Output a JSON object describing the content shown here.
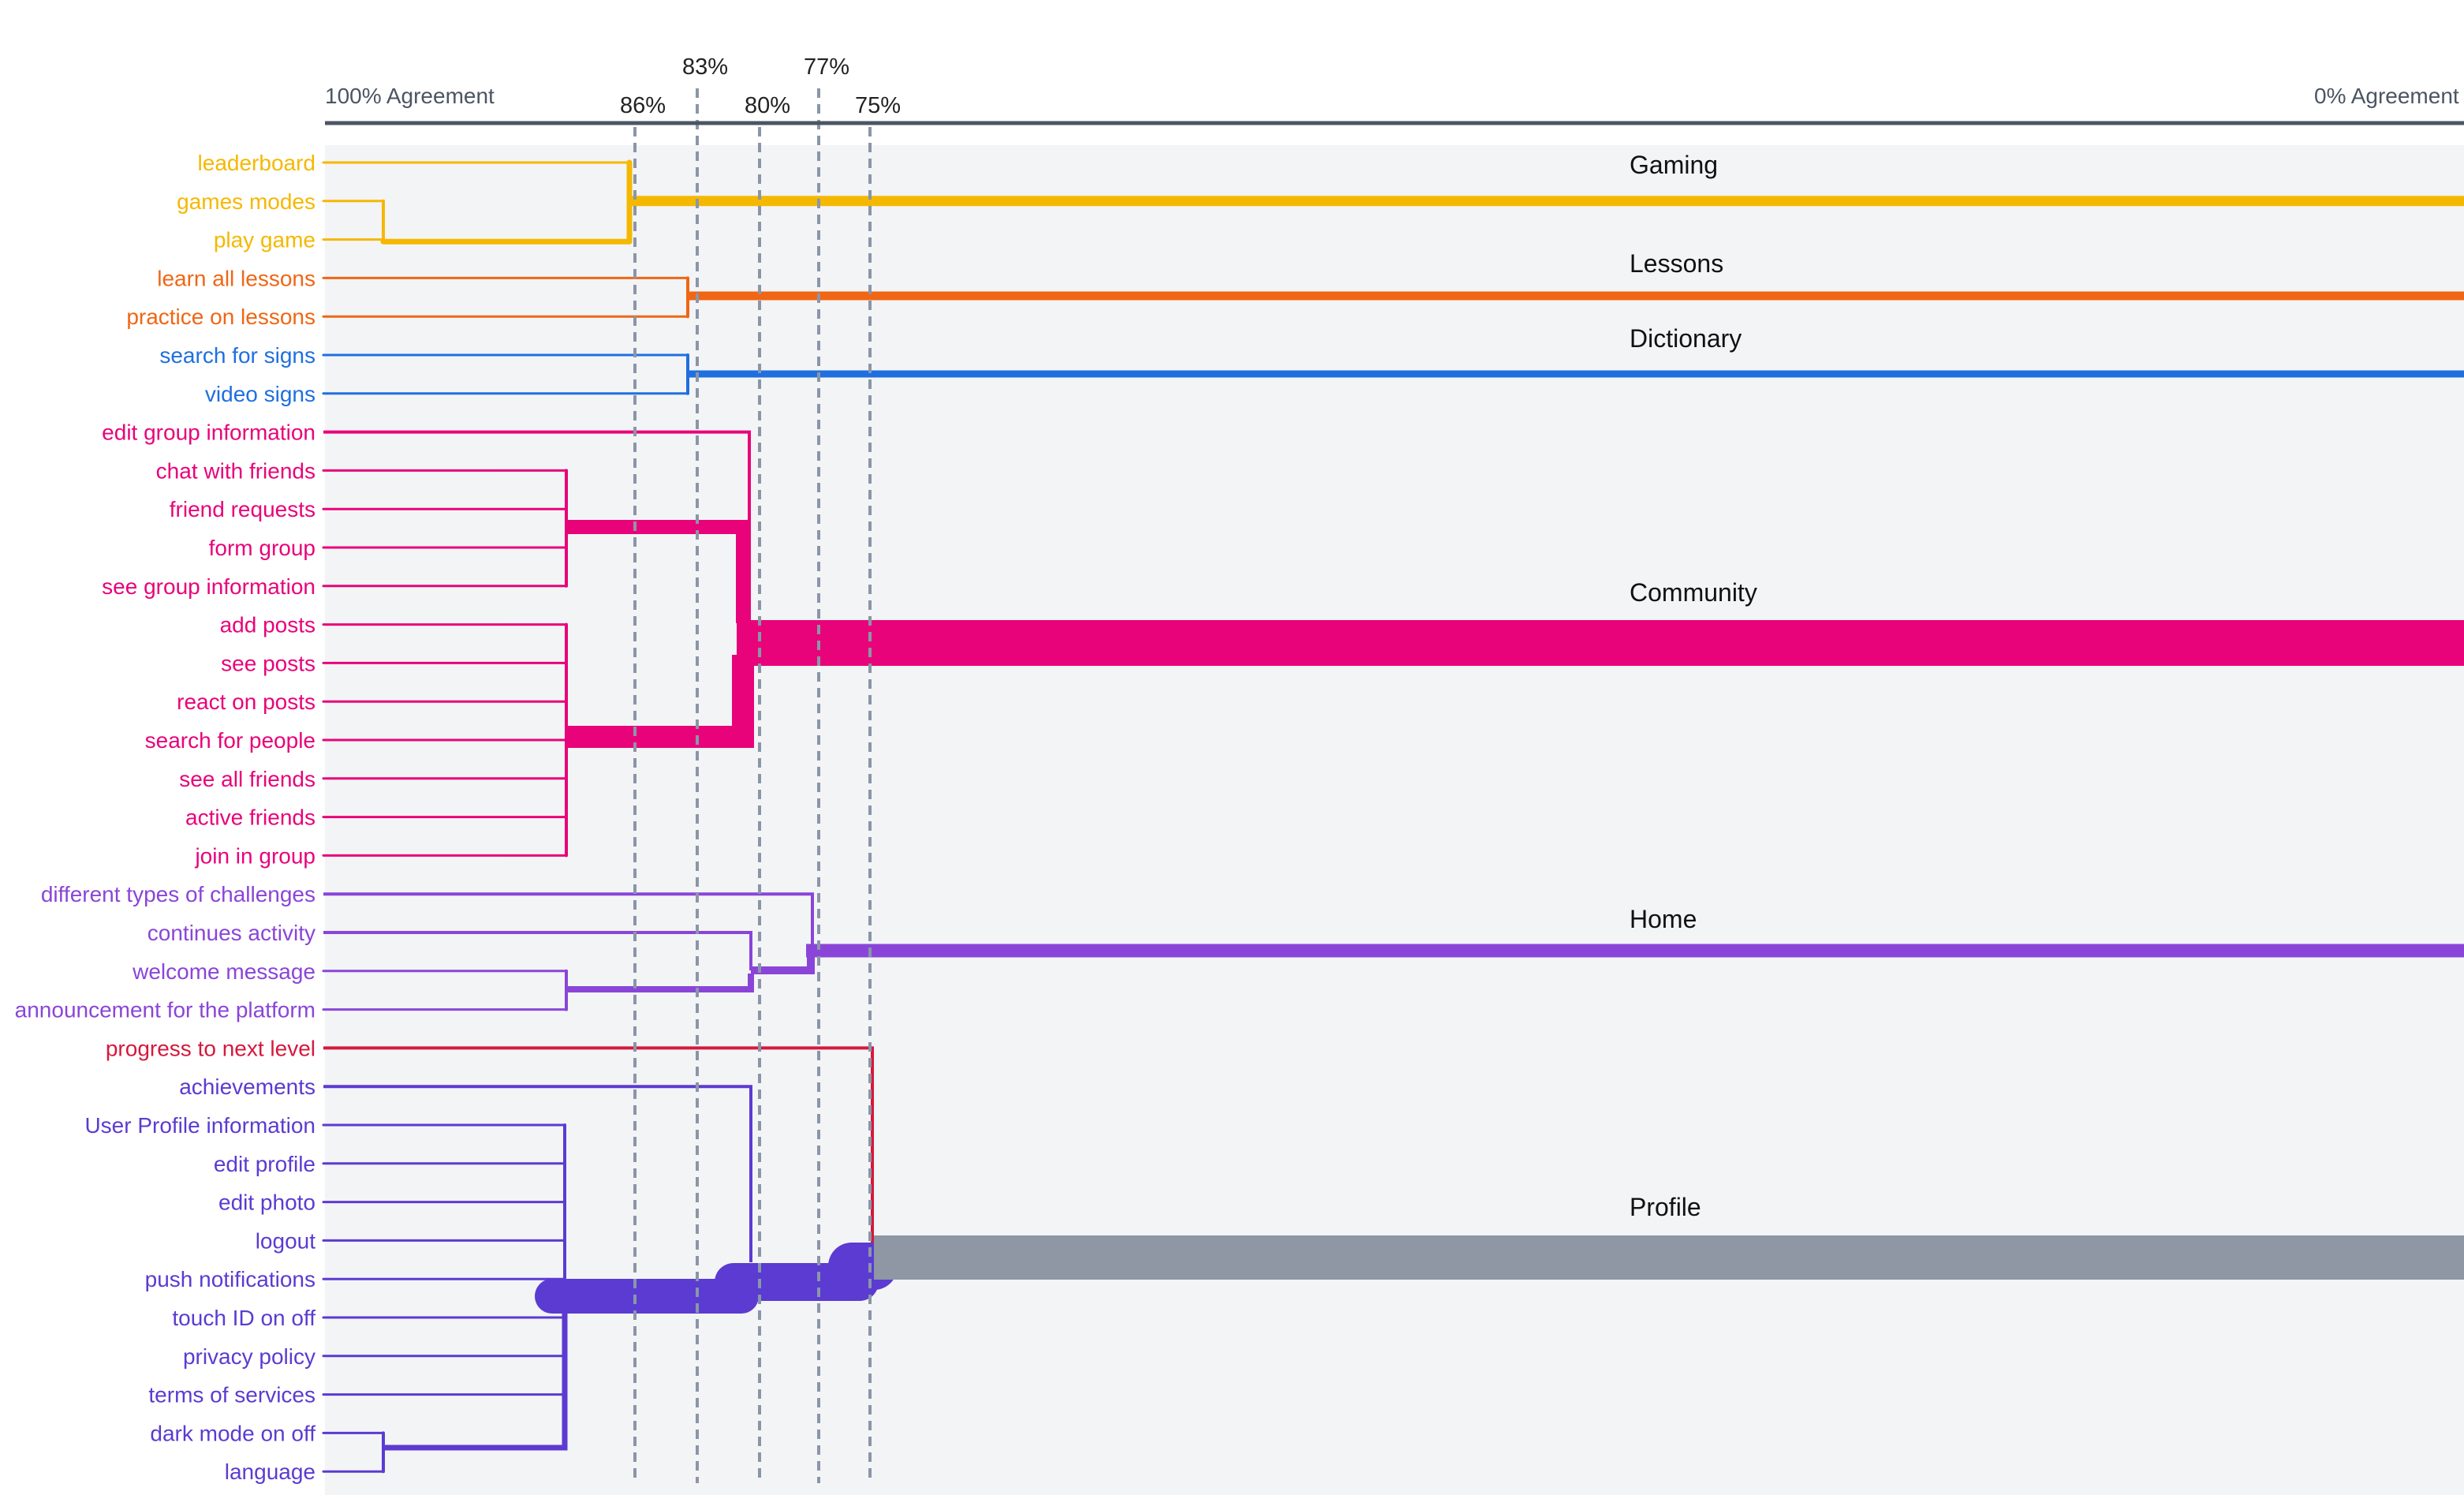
{
  "chart_data": {
    "type": "dendrogram",
    "axis": {
      "left_label": "100% Agreement",
      "right_label": "0% Agreement"
    },
    "thresholds": [
      {
        "label": "86%",
        "agreement": 86
      },
      {
        "label": "83%",
        "agreement": 83
      },
      {
        "label": "80%",
        "agreement": 80
      },
      {
        "label": "77%",
        "agreement": 77
      },
      {
        "label": "75%",
        "agreement": 75
      }
    ],
    "colors": {
      "Gaming": "#f5b800",
      "Lessons": "#f06614",
      "Dictionary": "#1f6fe0",
      "Community": "#e8037a",
      "Home": "#8a45d8",
      "Profile": "#5b3bd1",
      "Profile_outlier": "#d6183c",
      "Profile_bar": "#8e97a3",
      "background": "#f3f4f6",
      "axis": "#4b5563",
      "threshold_line": "#8a96a8"
    },
    "clusters": [
      {
        "name": "Gaming",
        "color_key": "Gaming",
        "leaves": [
          "leaderboard",
          "games modes",
          "play game"
        ]
      },
      {
        "name": "Lessons",
        "color_key": "Lessons",
        "leaves": [
          "learn all lessons",
          "practice on lessons"
        ]
      },
      {
        "name": "Dictionary",
        "color_key": "Dictionary",
        "leaves": [
          "search for signs",
          "video signs"
        ]
      },
      {
        "name": "Community",
        "color_key": "Community",
        "leaves": [
          "edit group information",
          "chat with friends",
          "friend requests",
          "form group",
          "see group information",
          "add posts",
          "see posts",
          "react on posts",
          "search for people",
          "see all friends",
          "active friends",
          "join in group"
        ]
      },
      {
        "name": "Home",
        "color_key": "Home",
        "leaves": [
          "different types of challenges",
          "continues activity",
          "welcome message",
          "announcement for the platform"
        ]
      },
      {
        "name": "Profile",
        "color_key": "Profile",
        "leaves": [
          "progress to next level",
          "achievements",
          "User Profile information",
          "edit profile",
          "edit photo",
          "logout",
          "push notifications",
          "touch ID on off",
          "privacy policy",
          "terms of services",
          "dark mode on off",
          "language"
        ]
      }
    ]
  }
}
